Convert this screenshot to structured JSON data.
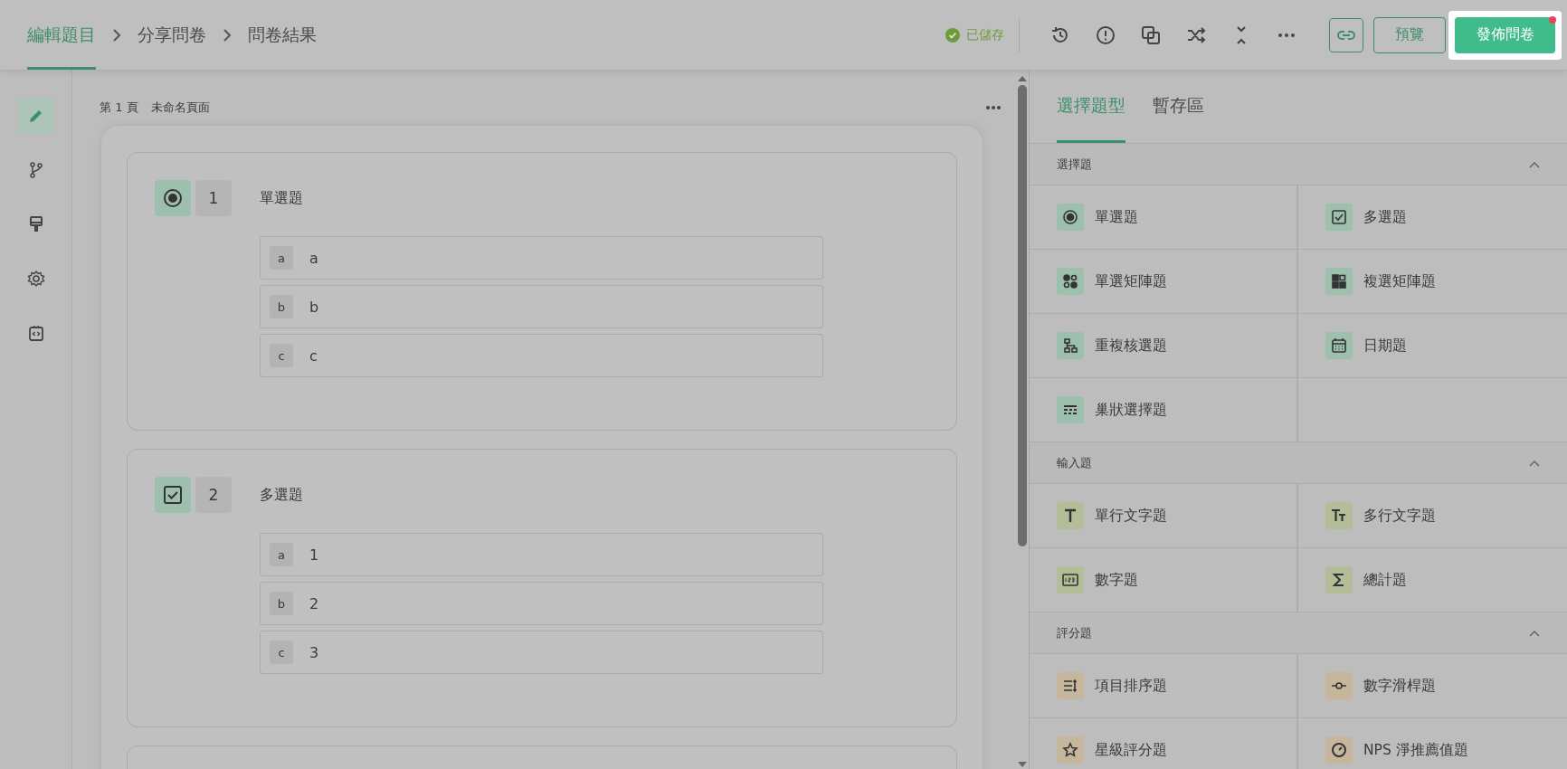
{
  "nav_steps": [
    {
      "label": "編輯題目",
      "selected": true
    },
    {
      "label": "分享問卷",
      "selected": false
    },
    {
      "label": "問卷結果",
      "selected": false
    }
  ],
  "save_status": "已儲存",
  "preview_button": "預覽",
  "publish_button": {
    "label": "發佈問卷",
    "notification": true
  },
  "sidebar": [
    {
      "selected": true
    },
    {
      "selected": false
    },
    {
      "selected": false
    },
    {
      "selected": false
    },
    {
      "selected": false
    }
  ],
  "page": {
    "number": "第 1 頁",
    "name": "未命名頁面"
  },
  "questions": [
    {
      "kind": "single",
      "number": "1",
      "title": "單選題",
      "options": [
        {
          "letter": "a",
          "text": "a"
        },
        {
          "letter": "b",
          "text": "b"
        },
        {
          "letter": "c",
          "text": "c"
        }
      ]
    },
    {
      "kind": "multiple",
      "number": "2",
      "title": "多選題",
      "options": [
        {
          "letter": "a",
          "text": "1"
        },
        {
          "letter": "b",
          "text": "2"
        },
        {
          "letter": "c",
          "text": "3"
        }
      ]
    }
  ],
  "panel_tabs": [
    {
      "label": "選擇題型",
      "selected": true
    },
    {
      "label": "暫存區",
      "selected": false
    }
  ],
  "sections": [
    {
      "title": "選擇題",
      "expanded": true,
      "color": "#9dbfae",
      "items": [
        {
          "kind": "radio",
          "label": "單選題"
        },
        {
          "kind": "checkbox",
          "label": "多選題"
        },
        {
          "kind": "matrix-radio",
          "label": "單選矩陣題"
        },
        {
          "kind": "matrix-check",
          "label": "複選矩陣題"
        },
        {
          "kind": "tree",
          "label": "重複核選題"
        },
        {
          "kind": "date",
          "label": "日期題"
        },
        {
          "kind": "nested",
          "label": "巢狀選擇題"
        }
      ]
    },
    {
      "title": "輸入題",
      "expanded": true,
      "color": "#b3bd97",
      "items": [
        {
          "kind": "text",
          "label": "單行文字題"
        },
        {
          "kind": "textarea",
          "label": "多行文字題"
        },
        {
          "kind": "number",
          "label": "數字題"
        },
        {
          "kind": "sum",
          "label": "總計題"
        }
      ]
    },
    {
      "title": "評分題",
      "expanded": true,
      "color": "#c6b69b",
      "items": [
        {
          "kind": "rank",
          "label": "項目排序題"
        },
        {
          "kind": "slider",
          "label": "數字滑桿題"
        },
        {
          "kind": "star",
          "label": "星級評分題"
        },
        {
          "kind": "nps",
          "label": "NPS 淨推薦值題"
        }
      ]
    }
  ]
}
